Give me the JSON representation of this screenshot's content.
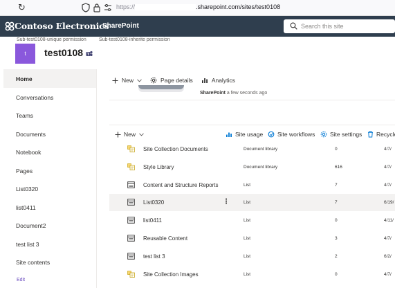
{
  "browser": {
    "url_scheme": "https://",
    "url_host": ".sharepoint.com/sites/test0108"
  },
  "suite": {
    "brand": "Contoso Electronics",
    "app": "SharePoint",
    "search_placeholder": "Search this site"
  },
  "hub_links": [
    "Sub-test0108-unique permission",
    "Sub-test0108-inherite permission"
  ],
  "site": {
    "logo_letter": "t",
    "title": "test0108"
  },
  "nav": {
    "items": [
      {
        "label": "Home",
        "active": true
      },
      {
        "label": "Conversations"
      },
      {
        "label": "Teams"
      },
      {
        "label": "Documents"
      },
      {
        "label": "Notebook"
      },
      {
        "label": "Pages"
      },
      {
        "label": "List0320"
      },
      {
        "label": "list0411"
      },
      {
        "label": "Document2"
      },
      {
        "label": "test list 3"
      },
      {
        "label": "Site contents"
      }
    ],
    "edit": "Edit"
  },
  "command_bar": {
    "new": "New",
    "page_details": "Page details",
    "analytics": "Analytics"
  },
  "activity": {
    "source": "SharePoint",
    "time": "a few seconds ago"
  },
  "library_bar": {
    "new": "New",
    "site_usage": "Site usage",
    "site_workflows": "Site workflows",
    "site_settings": "Site settings",
    "recycle": "Recycle"
  },
  "rows": [
    {
      "name": "Site Collection Documents",
      "type": "Document library",
      "count": "0",
      "modified": "4/7/",
      "icon": "library-icon"
    },
    {
      "name": "Style Library",
      "type": "Document library",
      "count": "616",
      "modified": "4/7/",
      "icon": "library-icon"
    },
    {
      "name": "Content and Structure Reports",
      "type": "List",
      "count": "7",
      "modified": "4/7/",
      "icon": "list-icon"
    },
    {
      "name": "List0320",
      "type": "List",
      "count": "7",
      "modified": "6/19/",
      "icon": "list-icon",
      "hover": true
    },
    {
      "name": "list0411",
      "type": "List",
      "count": "0",
      "modified": "4/11/",
      "icon": "list-icon"
    },
    {
      "name": "Reusable Content",
      "type": "List",
      "count": "3",
      "modified": "4/7/",
      "icon": "list-icon"
    },
    {
      "name": "test list 3",
      "type": "List",
      "count": "2",
      "modified": "6/2/",
      "icon": "list-icon"
    },
    {
      "name": "Site Collection Images",
      "type": "List",
      "count": "0",
      "modified": "4/7/",
      "icon": "library-icon"
    }
  ],
  "colors": {
    "suite_bar": "#2f3e4e",
    "site_logo": "#8a58dc",
    "accent": "#6a4bbf"
  }
}
